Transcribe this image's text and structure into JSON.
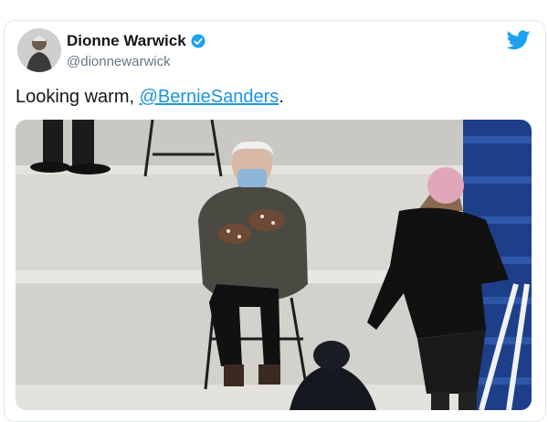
{
  "tweet": {
    "author_name": "Dionne Warwick",
    "author_handle": "@dionnewarwick",
    "text_before": "Looking warm, ",
    "mention": "@BernieSanders",
    "text_after": ".",
    "verified": true
  },
  "icons": {
    "verified": "verified-badge-icon",
    "platform": "twitter-bird-icon"
  },
  "colors": {
    "accent": "#1da1f2",
    "link": "#1b95e0",
    "text": "#14171a",
    "muted": "#657786"
  }
}
